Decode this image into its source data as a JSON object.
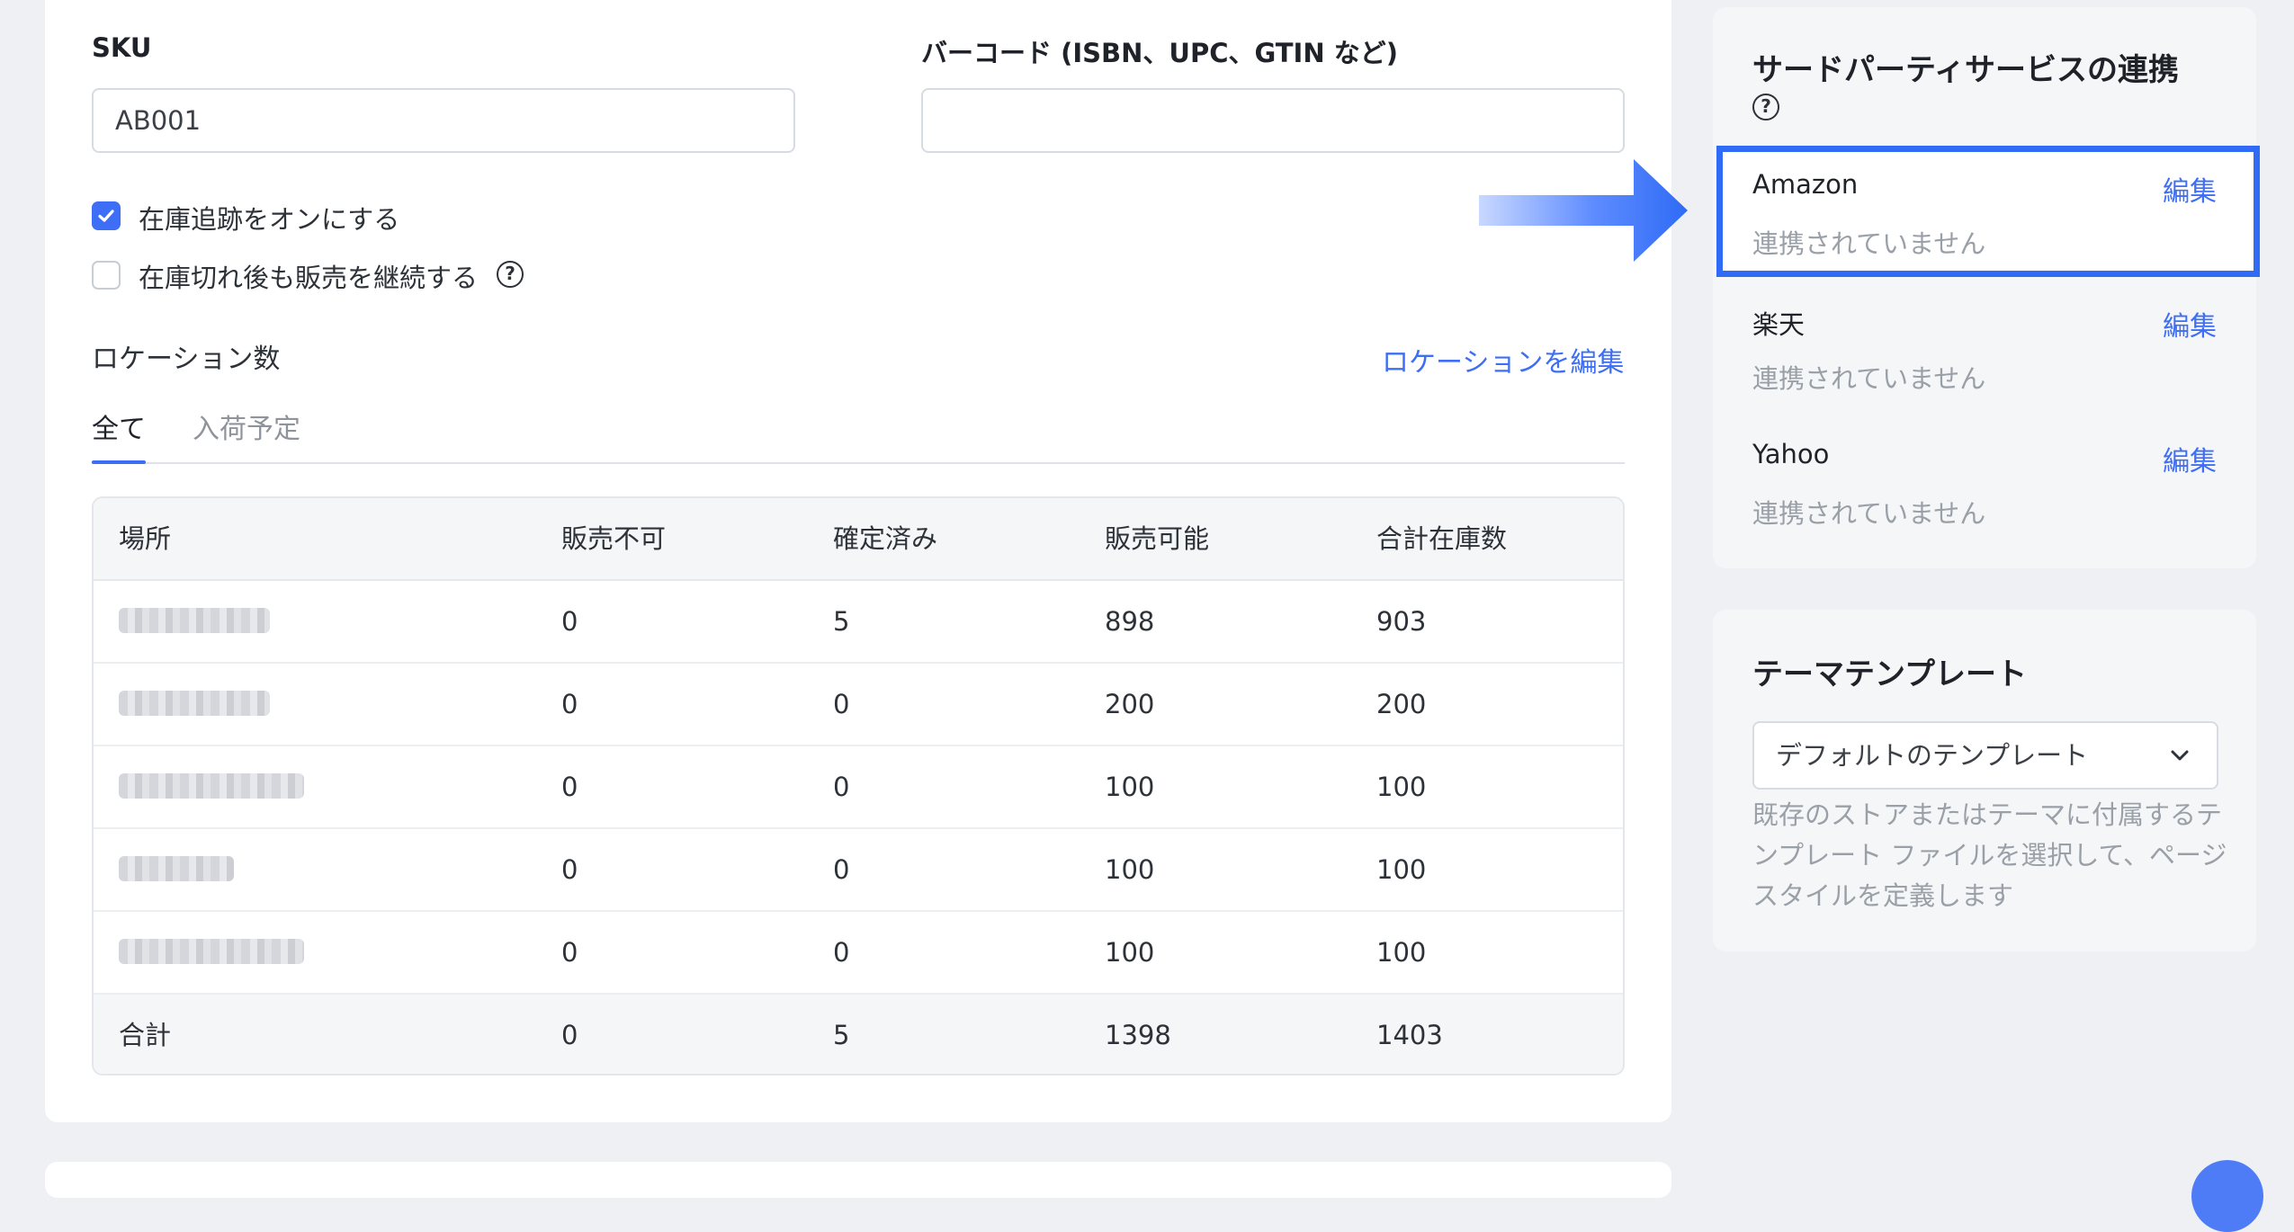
{
  "form": {
    "sku_label": "SKU",
    "sku_value": "AB001",
    "barcode_label": "バーコード (ISBN、UPC、GTIN など)",
    "barcode_value": "",
    "track_inventory_label": "在庫追跡をオンにする",
    "track_inventory_checked": true,
    "continue_selling_label": "在庫切れ後も販売を継続する",
    "continue_selling_checked": false
  },
  "locations": {
    "title": "ロケーション数",
    "edit_link": "ロケーションを編集",
    "tabs": [
      {
        "label": "全て",
        "active": true
      },
      {
        "label": "入荷予定",
        "active": false
      }
    ],
    "table": {
      "headers": [
        "場所",
        "販売不可",
        "確定済み",
        "販売可能",
        "合計在庫数"
      ],
      "rows": [
        {
          "place": "",
          "unavailable": "0",
          "committed": "5",
          "available": "898",
          "total": "903"
        },
        {
          "place": "",
          "unavailable": "0",
          "committed": "0",
          "available": "200",
          "total": "200"
        },
        {
          "place": "",
          "unavailable": "0",
          "committed": "0",
          "available": "100",
          "total": "100"
        },
        {
          "place": "",
          "unavailable": "0",
          "committed": "0",
          "available": "100",
          "total": "100"
        },
        {
          "place": "",
          "unavailable": "0",
          "committed": "0",
          "available": "100",
          "total": "100"
        }
      ],
      "footer": {
        "place": "合計",
        "unavailable": "0",
        "committed": "5",
        "available": "1398",
        "total": "1403"
      }
    }
  },
  "integrations": {
    "title": "サードパーティサービスの連携",
    "items": [
      {
        "name": "Amazon",
        "status": "連携されていません",
        "edit": "編集",
        "highlighted": true
      },
      {
        "name": "楽天",
        "status": "連携されていません",
        "edit": "編集",
        "highlighted": false
      },
      {
        "name": "Yahoo",
        "status": "連携されていません",
        "edit": "編集",
        "highlighted": false
      }
    ]
  },
  "theme": {
    "title": "テーマテンプレート",
    "selected": "デフォルトのテンプレート",
    "description": "既存のストアまたはテーマに付属するテンプレート ファイルを選択して、ページ スタイルを定義します"
  },
  "colors": {
    "accent": "#3d6ef5",
    "highlight_border": "#2f6bf5",
    "muted_text": "#9aa0a8"
  },
  "icons": [
    "checkbox-checked-icon",
    "help-icon",
    "chevron-down-icon",
    "arrow-right-icon"
  ]
}
